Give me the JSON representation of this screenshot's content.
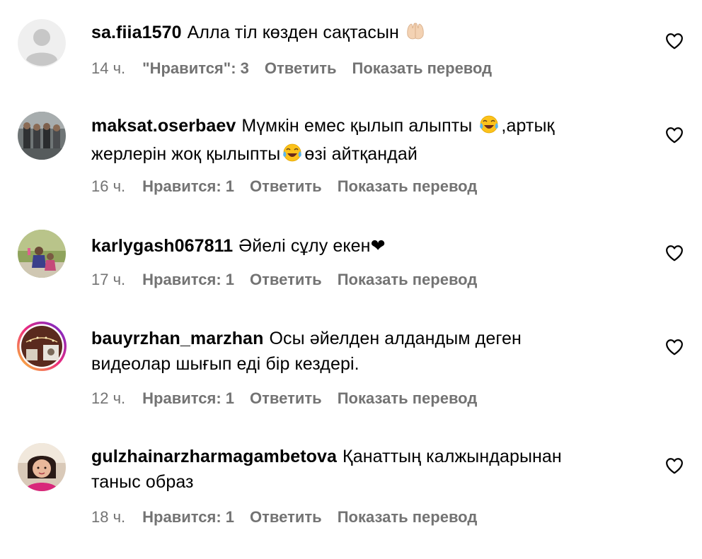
{
  "comments": [
    {
      "username": "sa.fiia1570",
      "text": "Алла тіл көзден сақтасын",
      "emoji": "raised-hands",
      "text_after": "",
      "time": "14 ч.",
      "likes": "\"Нравится\": 3",
      "reply": "Ответить",
      "translate": "Показать перевод"
    },
    {
      "username": "maksat.oserbaev",
      "text": "Мүмкін емес қылып алыпты",
      "emoji": "tears-of-joy",
      "text_after": ",артық",
      "text_line2": "жерлерін жоқ қылыпты",
      "text_line2_after": "өзі айтқандай",
      "time": "16 ч.",
      "likes": "Нравится: 1",
      "reply": "Ответить",
      "translate": "Показать перевод"
    },
    {
      "username": "karlygash067811",
      "text": "Әйелі сұлу екен❤",
      "time": "17 ч.",
      "likes": "Нравится: 1",
      "reply": "Ответить",
      "translate": "Показать перевод"
    },
    {
      "username": "bauyrzhan_marzhan",
      "text": "Осы әйелден алдандым деген",
      "text_line2": "видеолар шығып еді бір кездері.",
      "time": "12 ч.",
      "likes": "Нравится: 1",
      "reply": "Ответить",
      "translate": "Показать перевод"
    },
    {
      "username": "gulzhainarzharmagambetova",
      "text": "Қанаттың калжындарынан",
      "text_line2": "таныс образ",
      "time": "18 ч.",
      "likes": "Нравится: 1",
      "reply": "Ответить",
      "translate": "Показать перевод"
    }
  ],
  "icons": {
    "like": "heart-outline-icon"
  },
  "colors": {
    "text": "#000000",
    "meta": "#737373",
    "story_ring_start": "#f9ce34",
    "story_ring_mid": "#ee2a7b",
    "story_ring_end": "#6228d7"
  }
}
